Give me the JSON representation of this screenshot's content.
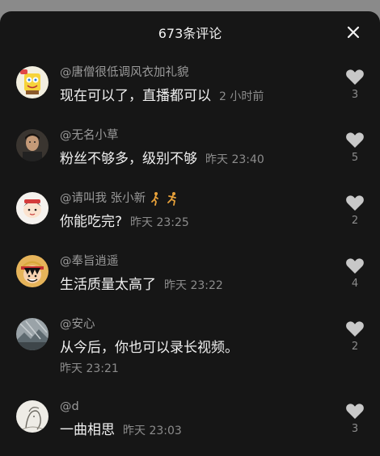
{
  "header": {
    "title": "673条评论"
  },
  "comments": [
    {
      "username": "@唐僧很低调风衣加礼貌",
      "text": "现在可以了，直播都可以",
      "time": "2 小时前",
      "likes": "3",
      "avatar_icon": "cartoon-avatar-icon"
    },
    {
      "username": "@无名小草",
      "text": "粉丝不够多，级别不够",
      "time": "昨天 23:40",
      "likes": "5",
      "avatar_icon": "man-photo-avatar-icon"
    },
    {
      "username": "@请叫我  张小新",
      "text": "你能吃完?",
      "time": "昨天 23:25",
      "likes": "2",
      "avatar_icon": "cartoon-avatar-icon",
      "username_icons": [
        "walking-person-icon",
        "running-person-icon"
      ]
    },
    {
      "username": "@奉旨逍遥",
      "text": "生活质量太高了",
      "time": "昨天 23:22",
      "likes": "4",
      "avatar_icon": "anime-avatar-icon"
    },
    {
      "username": "@安心",
      "text": "从今后，你也可以录长视频。",
      "time": "昨天 23:21",
      "likes": "2",
      "avatar_icon": "photo-avatar-icon"
    },
    {
      "username": "@d",
      "text": "一曲相思",
      "time": "昨天 23:03",
      "likes": "3",
      "avatar_icon": "sketch-avatar-icon"
    }
  ],
  "colors": {
    "background": "#161616",
    "username": "#9a9a9a",
    "text": "#f0f0f0",
    "secondary": "#8c8c8c",
    "heart": "#c8c8c8"
  }
}
